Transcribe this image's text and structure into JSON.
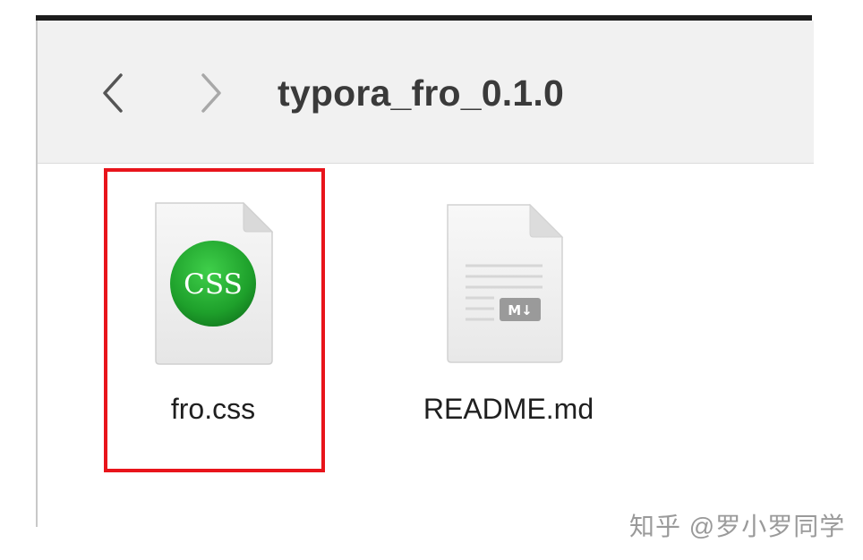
{
  "window": {
    "title": "typora_fro_0.1.0"
  },
  "toolbar": {
    "back_icon": "chevron-left-icon",
    "forward_icon": "chevron-right-icon"
  },
  "files": [
    {
      "name": "fro.css",
      "icon": "css-file-icon",
      "icon_badge": "CSS",
      "selected_highlight": true
    },
    {
      "name": "README.md",
      "icon": "markdown-file-icon",
      "icon_badge": "M↓",
      "selected_highlight": false
    }
  ],
  "annotation": {
    "highlight_color": "#e8141b"
  },
  "watermark": {
    "text": "知乎 @罗小罗同学"
  },
  "colors": {
    "toolbar_bg": "#f1f1f1",
    "css_badge_green": "#21a32f",
    "title_text": "#3a3a3a"
  }
}
